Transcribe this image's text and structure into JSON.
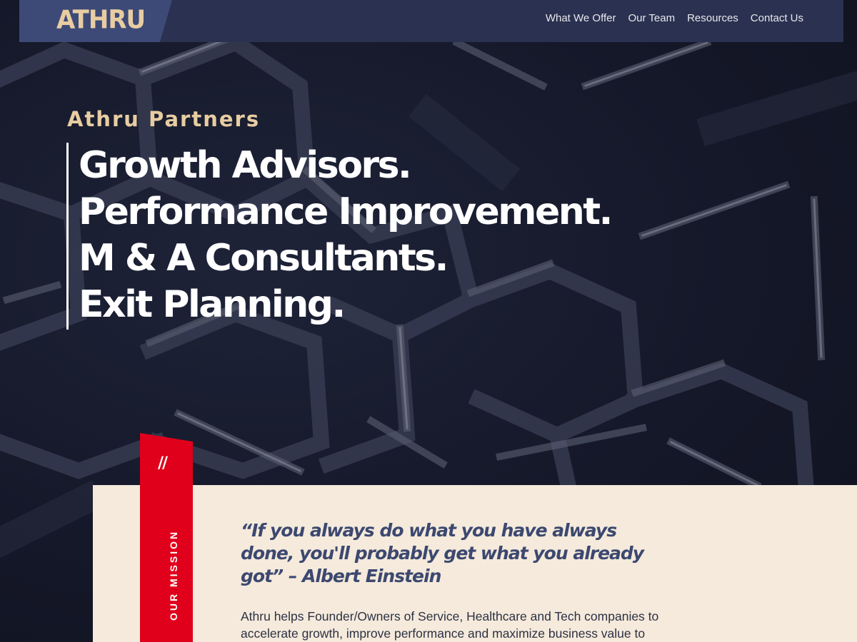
{
  "nav": {
    "logo": "ATHRU",
    "links": [
      "What We Offer",
      "Our Team",
      "Resources",
      "Contact Us"
    ]
  },
  "hero": {
    "eyebrow": "Athru Partners",
    "headlines": [
      "Growth Advisors.",
      "Performance Improvement.",
      "M & A Consultants.",
      "Exit Planning."
    ]
  },
  "mission": {
    "tab_slashes": "//",
    "tab_label": "OUR MISSION",
    "quote": "“If you always do what you have always done, you'll probably get what you already got” – Albert Einstein",
    "body": "Athru helps Founder/Owners of Service, Healthcare and Tech companies to accelerate growth, improve performance and maximize business value to"
  },
  "colors": {
    "background": "#161a2c",
    "nav_bar": "#2b3150",
    "logo_block": "#3d4a78",
    "accent_gold": "#e8cda2",
    "accent_red": "#e0001b",
    "cream": "#f5eadb",
    "quote_navy": "#3c4870"
  }
}
